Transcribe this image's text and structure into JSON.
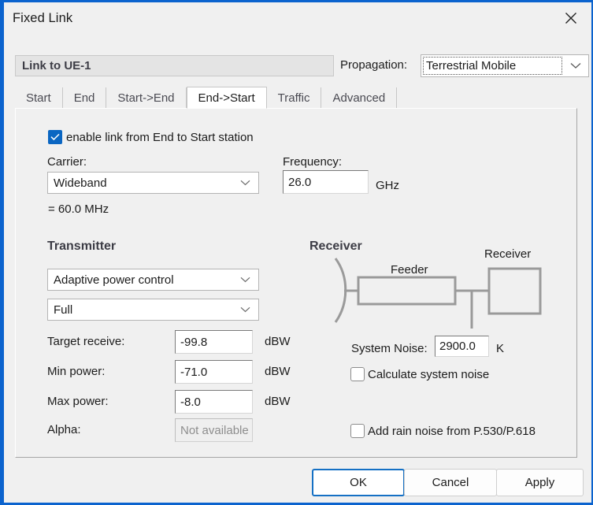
{
  "window": {
    "title": "Fixed Link",
    "close_icon": "close-icon",
    "accent_color": "#0b63ce",
    "background_color": "#f0f0f0"
  },
  "header": {
    "link_name": "Link to UE-1",
    "propagation_label": "Propagation:",
    "propagation_value": "Terrestrial Mobile",
    "dropdown_icon": "chevron-down-icon"
  },
  "tabs": [
    {
      "label": "Start",
      "active": false
    },
    {
      "label": "End",
      "active": false
    },
    {
      "label": "Start->End",
      "active": false
    },
    {
      "label": "End->Start",
      "active": true
    },
    {
      "label": "Traffic",
      "active": false
    },
    {
      "label": "Advanced",
      "active": false
    }
  ],
  "form": {
    "enable": {
      "label": "enable link from End to Start station",
      "checked": true
    },
    "carrier": {
      "label": "Carrier:",
      "value": "Wideband",
      "bandwidth_note": "= 60.0 MHz"
    },
    "frequency": {
      "label": "Frequency:",
      "value": "26.0",
      "unit": "GHz"
    }
  },
  "transmitter": {
    "heading": "Transmitter",
    "power_control": "Adaptive power control",
    "power_mode": "Full",
    "rows": [
      {
        "label": "Target receive:",
        "value": "-99.8",
        "unit": "dBW",
        "disabled": false
      },
      {
        "label": "Min power:",
        "value": "-71.0",
        "unit": "dBW",
        "disabled": false
      },
      {
        "label": "Max power:",
        "value": "-8.0",
        "unit": "dBW",
        "disabled": false
      },
      {
        "label": "Alpha:",
        "value": "Not available",
        "unit": "",
        "disabled": true
      }
    ]
  },
  "receiver": {
    "heading": "Receiver",
    "diagram": {
      "antenna_icon": "antenna-arc-icon",
      "feeder_label": "Feeder",
      "receiver_label": "Receiver"
    },
    "system_noise": {
      "label": "System Noise:",
      "value": "2900.0",
      "unit": "K"
    },
    "calculate_system_noise": {
      "label": "Calculate system noise",
      "checked": false
    },
    "add_rain_noise": {
      "label": "Add rain noise from P.530/P.618",
      "checked": false
    }
  },
  "footer": {
    "ok": "OK",
    "cancel": "Cancel",
    "apply": "Apply"
  }
}
